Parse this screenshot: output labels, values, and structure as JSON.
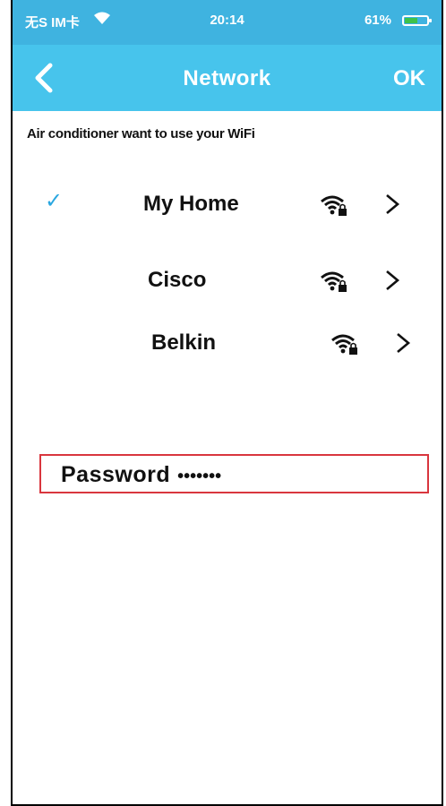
{
  "status_bar": {
    "carrier": "无S IM卡",
    "time": "20:14",
    "battery": "61%",
    "battery_level": 0.61
  },
  "nav": {
    "title": "Network",
    "ok_label": "OK"
  },
  "subtitle": "Air conditioner want to use your WiFi",
  "networks": [
    {
      "name": "My Home",
      "selected": true,
      "secured": true
    },
    {
      "name": "Cisco",
      "selected": false,
      "secured": true
    },
    {
      "name": "Belkin",
      "selected": false,
      "secured": true
    }
  ],
  "password": {
    "label": "Password",
    "value": "•••••••"
  },
  "colors": {
    "status_bar": "#3fb3e0",
    "nav_bar": "#47c4ec",
    "checkmark": "#2aa7e0",
    "password_border": "#d9363e"
  }
}
